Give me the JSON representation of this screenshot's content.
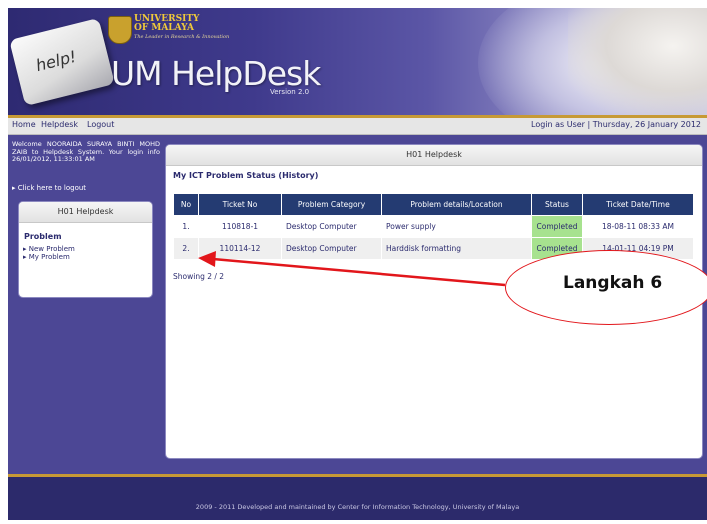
{
  "banner": {
    "key_label": "help!",
    "university_line1": "UNIVERSITY",
    "university_line2": "OF MALAYA",
    "university_tagline": "The Leader in Research & Innovation",
    "app_title": "UM HelpDesk",
    "version": "Version 2.0"
  },
  "nav": {
    "home": "Home",
    "helpdesk": "Helpdesk",
    "logout": "Logout",
    "login_info": "Login as User | Thursday, 26 January 2012"
  },
  "sidebar": {
    "welcome_text": "Welcome NOORAIDA SURAYA BINTI MOHD ZAIB to Helpdesk System. Your login info 26/01/2012, 11:33:01 AM",
    "logout_link": "Click here to logout",
    "box_title": "H01 Helpdesk",
    "section_title": "Problem",
    "items": [
      "New Problem",
      "My Problem"
    ]
  },
  "main": {
    "panel_title": "H01 Helpdesk",
    "heading": "My ICT Problem Status (History)",
    "columns": [
      "No",
      "Ticket No",
      "Problem Category",
      "Problem details/Location",
      "Status",
      "Ticket Date/Time"
    ],
    "rows": [
      {
        "no": "1.",
        "ticket": "110818-1",
        "category": "Desktop Computer",
        "details": "Power supply",
        "status": "Completed",
        "datetime": "18-08-11 08:33 AM"
      },
      {
        "no": "2.",
        "ticket": "110114-12",
        "category": "Desktop Computer",
        "details": "Harddisk formatting",
        "status": "Completed",
        "datetime": "14-01-11 04:19 PM"
      }
    ],
    "showing": "Showing 2 / 2"
  },
  "annotation": {
    "label": "Langkah 6",
    "color": "#e2161b"
  },
  "footer": {
    "text": "2009 - 2011 Developed and maintained by Center for Information Technology, University of Malaya"
  },
  "colors": {
    "page_bg": "#4c4795",
    "table_header": "#243b72",
    "status_completed": "#a7e28f",
    "accent_gold": "#c79a35"
  }
}
